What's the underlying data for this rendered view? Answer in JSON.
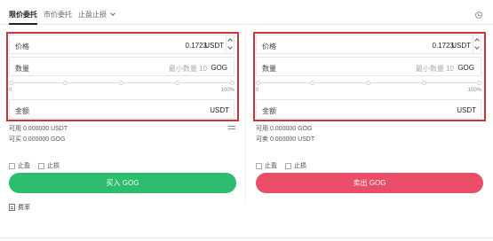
{
  "tabs": {
    "limit": "限价委托",
    "market": "市价委托",
    "stop": "止盈止损"
  },
  "buy": {
    "price_label": "价格",
    "price_value": "0.1723",
    "price_unit": "USDT",
    "qty_label": "数量",
    "qty_placeholder": "最小数量 10",
    "qty_unit": "GOG",
    "slider_min": "0",
    "slider_max": "100%",
    "amount_label": "金额",
    "amount_unit": "USDT",
    "avail_usdt": "可用 0.000000 USDT",
    "avail_gog": "可买 0.000000 GOG",
    "take_profit": "止盈",
    "stop_loss": "止损",
    "button": "买入 GOG"
  },
  "sell": {
    "price_label": "价格",
    "price_value": "0.1723",
    "price_unit": "USDT",
    "qty_label": "数量",
    "qty_placeholder": "最小数量 10",
    "qty_unit": "GOG",
    "slider_min": "0",
    "slider_max": "100%",
    "amount_label": "金额",
    "amount_unit": "USDT",
    "avail_gog": "可用 0.000000 GOG",
    "avail_usdt": "可卖 0.000000 USDT",
    "take_profit": "止盈",
    "stop_loss": "止损",
    "button": "卖出 GOG"
  },
  "fee": "费率",
  "colors": {
    "buy": "#2dbd6e",
    "sell": "#ea4d68",
    "highlight": "#c9363b"
  },
  "icons": {
    "stepper": "chevron-up-down-icon",
    "history": "clock-icon",
    "swap": "swap-icon",
    "fee": "document-icon"
  }
}
